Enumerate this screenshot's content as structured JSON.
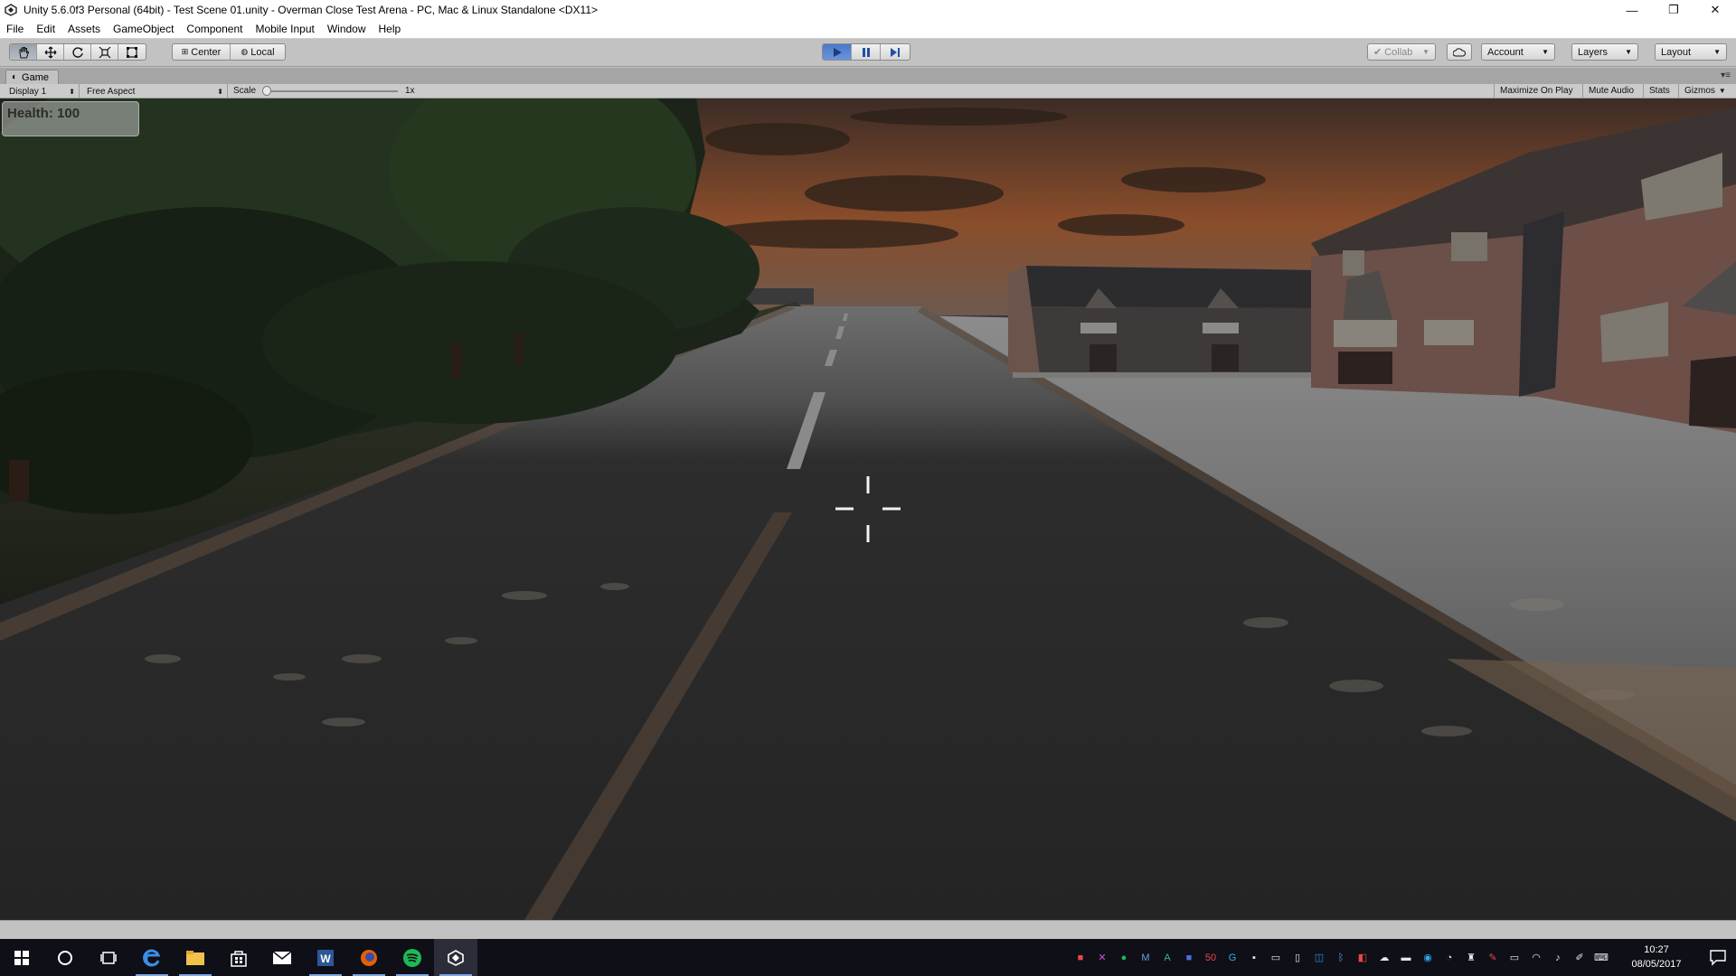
{
  "window": {
    "title": "Unity 5.6.0f3 Personal (64bit) - Test Scene 01.unity - Overman Close Test Arena - PC, Mac & Linux Standalone <DX11>",
    "minimize": "—",
    "restore": "❐",
    "close": "✕"
  },
  "menu": [
    "File",
    "Edit",
    "Assets",
    "GameObject",
    "Component",
    "Mobile Input",
    "Window",
    "Help"
  ],
  "toolbar": {
    "pivot_label": "Center",
    "space_label": "Local",
    "collab_label": "Collab",
    "account_label": "Account",
    "layers_label": "Layers",
    "layout_label": "Layout"
  },
  "game_tab": {
    "label": "Game"
  },
  "game_bar": {
    "display": "Display 1",
    "aspect": "Free Aspect",
    "scale_label": "Scale",
    "scale_value": "1x",
    "maximize": "Maximize On Play",
    "mute": "Mute Audio",
    "stats": "Stats",
    "gizmos": "Gizmos"
  },
  "hud": {
    "health": "Health: 100"
  },
  "taskbar": {
    "time": "10:27",
    "date": "08/05/2017"
  },
  "colors": {
    "accent_play": "#4a78c8",
    "editor_bg": "#c2c2c2",
    "taskbar_bg": "#0f0f17"
  }
}
